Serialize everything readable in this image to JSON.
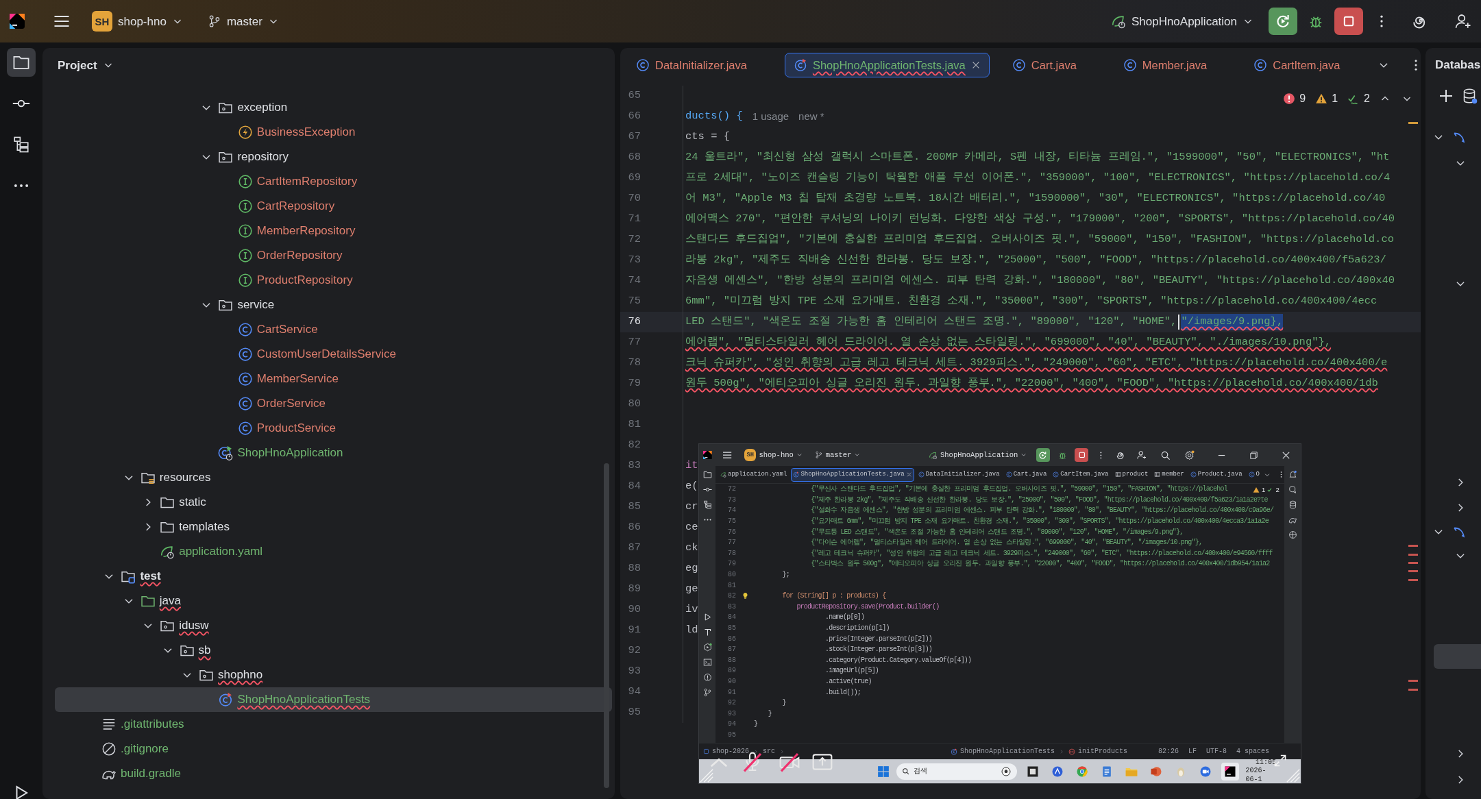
{
  "topbar": {
    "project_badge": "SH",
    "project": "shop-hno",
    "branch": "master",
    "run_config": "ShopHnoApplication"
  },
  "tool_strip": [
    {
      "kind": "project",
      "selected": true
    },
    {
      "kind": "commit",
      "selected": false
    },
    {
      "kind": "structure",
      "selected": false
    },
    {
      "kind": "more",
      "selected": false
    },
    {
      "kind": "run",
      "selected": false
    }
  ],
  "project_panel": {
    "title": "Project",
    "tree": [
      {
        "children": [
          {
            "children": [
              {
                "children": [
                  {
                    "children": [
                      {
                        "children": [
                          {
                            "children": [
                              {
                                "label": "exception",
                                "kind": "package",
                                "color": "#dfe1e5",
                                "expanded": true,
                                "selected": false,
                                "error": false,
                                "children": [
                                  {
                                    "label": "BusinessException",
                                    "kind": "exception",
                                    "color": "#df7f6e",
                                    "selected": false,
                                    "error": false
                                  }
                                ]
                              },
                              {
                                "label": "repository",
                                "kind": "package",
                                "color": "#dfe1e5",
                                "expanded": true,
                                "selected": false,
                                "error": false,
                                "children": [
                                  {
                                    "label": "CartItemRepository",
                                    "kind": "interface",
                                    "color": "#df7f6e",
                                    "selected": false,
                                    "error": false
                                  },
                                  {
                                    "label": "CartRepository",
                                    "kind": "interface",
                                    "color": "#df7f6e",
                                    "selected": false,
                                    "error": false
                                  },
                                  {
                                    "label": "MemberRepository",
                                    "kind": "interface",
                                    "color": "#df7f6e",
                                    "selected": false,
                                    "error": false
                                  },
                                  {
                                    "label": "OrderRepository",
                                    "kind": "interface",
                                    "color": "#df7f6e",
                                    "selected": false,
                                    "error": false
                                  },
                                  {
                                    "label": "ProductRepository",
                                    "kind": "interface",
                                    "color": "#df7f6e",
                                    "selected": false,
                                    "error": false
                                  }
                                ]
                              },
                              {
                                "label": "service",
                                "kind": "package",
                                "color": "#dfe1e5",
                                "expanded": true,
                                "selected": false,
                                "error": false,
                                "children": [
                                  {
                                    "label": "CartService",
                                    "kind": "class",
                                    "color": "#df7f6e",
                                    "selected": false,
                                    "error": false
                                  },
                                  {
                                    "label": "CustomUserDetailsService",
                                    "kind": "class",
                                    "color": "#df7f6e",
                                    "selected": false,
                                    "error": false
                                  },
                                  {
                                    "label": "MemberService",
                                    "kind": "class",
                                    "color": "#df7f6e",
                                    "selected": false,
                                    "error": false
                                  },
                                  {
                                    "label": "OrderService",
                                    "kind": "class",
                                    "color": "#df7f6e",
                                    "selected": false,
                                    "error": false
                                  },
                                  {
                                    "label": "ProductService",
                                    "kind": "class",
                                    "color": "#df7f6e",
                                    "selected": false,
                                    "error": false
                                  }
                                ]
                              },
                              {
                                "label": "ShopHnoApplication",
                                "kind": "spring-class",
                                "color": "#6fb56f",
                                "selected": false,
                                "error": false
                              }
                            ]
                          }
                        ]
                      }
                    ]
                  }
                ]
              },
              {
                "label": "resources",
                "kind": "resources",
                "color": "#dfe1e5",
                "expanded": true,
                "selected": false,
                "error": false,
                "children": [
                  {
                    "label": "static",
                    "kind": "folder",
                    "color": "#dfe1e5",
                    "expanded": false,
                    "selected": false,
                    "error": false
                  },
                  {
                    "label": "templates",
                    "kind": "folder",
                    "color": "#dfe1e5",
                    "expanded": false,
                    "selected": false,
                    "error": false
                  },
                  {
                    "label": "application.yaml",
                    "kind": "yaml",
                    "color": "#6fb56f",
                    "selected": false,
                    "error": false
                  }
                ]
              }
            ]
          },
          {
            "label": "test",
            "kind": "test-root",
            "color": "#dfe1e5",
            "expanded": true,
            "selected": false,
            "error": true,
            "children": [
              {
                "label": "java",
                "kind": "test-folder",
                "color": "#dfe1e5",
                "expanded": true,
                "selected": false,
                "error": true,
                "children": [
                  {
                    "label": "idusw",
                    "kind": "package",
                    "color": "#dfe1e5",
                    "expanded": true,
                    "selected": false,
                    "error": true,
                    "children": [
                      {
                        "label": "sb",
                        "kind": "package",
                        "color": "#dfe1e5",
                        "expanded": true,
                        "selected": false,
                        "error": true,
                        "children": [
                          {
                            "label": "shophno",
                            "kind": "package",
                            "color": "#dfe1e5",
                            "expanded": true,
                            "selected": false,
                            "error": true,
                            "children": [
                              {
                                "label": "ShopHnoApplicationTests",
                                "kind": "test-class",
                                "color": "#6fb56f",
                                "selected": true,
                                "error": true
                              }
                            ]
                          }
                        ]
                      }
                    ]
                  }
                ]
              }
            ]
          }
        ]
      },
      {
        "label": ".gitattributes",
        "kind": "text",
        "color": "#6fb56f",
        "selected": false,
        "error": false
      },
      {
        "label": ".gitignore",
        "kind": "ignore",
        "color": "#6fb56f",
        "selected": false,
        "error": false
      },
      {
        "label": "build.gradle",
        "kind": "gradle",
        "color": "#6fb56f",
        "selected": false,
        "error": false
      }
    ]
  },
  "editor": {
    "tabs": [
      {
        "label": "DataInitializer.java",
        "kind": "class",
        "color": "#df7f6e",
        "selected": false,
        "error": false
      },
      {
        "label": "ShopHnoApplicationTests.java",
        "kind": "test-class",
        "color": "#6fb56f",
        "selected": true,
        "error": true
      },
      {
        "label": "Cart.java",
        "kind": "class",
        "color": "#df7f6e",
        "selected": false,
        "error": false
      },
      {
        "label": "Member.java",
        "kind": "class",
        "color": "#df7f6e",
        "selected": false,
        "error": false
      },
      {
        "label": "CartItem.java",
        "kind": "class",
        "color": "#df7f6e",
        "selected": false,
        "error": false
      }
    ],
    "inspections": {
      "errors": "9",
      "warnings": "1",
      "typos": "2"
    },
    "lines": [
      {
        "number": "65",
        "current": false
      },
      {
        "number": "66",
        "text": "ducts() {",
        "kind": "decl",
        "hints": [
          "1 usage",
          "new *"
        ],
        "current": false,
        "error": false
      },
      {
        "number": "67",
        "text": "cts = {",
        "kind": "code",
        "current": false,
        "error": false
      },
      {
        "number": "68",
        "text": "24 울트라\", \"최신형 삼성 갤럭시 스마트폰. 200MP 카메라, S펜 내장, 티타늄 프레임.\", \"1599000\", \"50\", \"ELECTRONICS\", \"ht",
        "kind": "string",
        "current": false,
        "error": false
      },
      {
        "number": "69",
        "text": "프로 2세대\", \"노이즈 캔슬링 기능이 탁월한 애플 무선 이어폰.\", \"359000\", \"100\", \"ELECTRONICS\", \"https://placehold.co/4",
        "kind": "string",
        "current": false,
        "error": false
      },
      {
        "number": "70",
        "text": "어 M3\", \"Apple M3 칩 탑재 초경량 노트북. 18시간 배터리.\", \"1590000\", \"30\", \"ELECTRONICS\", \"https://placehold.co/40",
        "kind": "string",
        "current": false,
        "error": false
      },
      {
        "number": "71",
        "text": "에어맥스 270\", \"편안한 쿠셔닝의 나이키 런닝화. 다양한 색상 구성.\", \"179000\", \"200\", \"SPORTS\", \"https://placehold.co/40",
        "kind": "string",
        "current": false,
        "error": false
      },
      {
        "number": "72",
        "text": "스탠다드 후드집업\", \"기본에 충실한 프리미엄 후드집업. 오버사이즈 핏.\", \"59000\", \"150\", \"FASHION\", \"https://placehold.co",
        "kind": "string",
        "current": false,
        "error": false
      },
      {
        "number": "73",
        "text": "라봉 2kg\", \"제주도 직배송 신선한 한라봉. 당도 보장.\", \"25000\", \"500\", \"FOOD\", \"https://placehold.co/400x400/f5a623/",
        "kind": "string",
        "current": false,
        "error": false
      },
      {
        "number": "74",
        "text": "자음생 에센스\", \"한방 성분의 프리미엄 에센스. 피부 탄력 강화.\", \"180000\", \"80\", \"BEAUTY\", \"https://placehold.co/400x40",
        "kind": "string",
        "current": false,
        "error": false
      },
      {
        "number": "75",
        "text": "6mm\", \"미끄럼 방지 TPE 소재 요가매트. 친환경 소재.\", \"35000\", \"300\", \"SPORTS\", \"https://placehold.co/400x400/4ecc",
        "kind": "string",
        "current": false,
        "error": false
      },
      {
        "number": "76",
        "text": "LED 스탠드\", \"색온도 조절 가능한 홈 인테리어 스탠드 조명.\", \"89000\", \"120\", \"HOME\",",
        "selection": "\"/images/9.png},",
        "kind": "string",
        "current": true,
        "error": true
      },
      {
        "number": "77",
        "text": "에어랩\", \"멀티스타일러 헤어 드라이어. 열 손상 없는 스타일링.\", \"699000\", \"40\", \"BEAUTY\", \"./images/10.png\"},",
        "kind": "string",
        "current": false,
        "error": true
      },
      {
        "number": "78",
        "text": "크닉 슈퍼카\", \"성인 취향의 고급 레고 테크닉 세트. 3929피스.\", \"249000\", \"60\", \"ETC\", \"https://placehold.co/400x400/e",
        "kind": "string",
        "current": false,
        "error": true
      },
      {
        "number": "79",
        "text": "원두 500g\", \"에티오피아 싱글 오리진 원두. 과일향 풍부.\", \"22000\", \"400\", \"FOOD\", \"https://placehold.co/400x400/1db",
        "kind": "string",
        "current": false,
        "error": true
      },
      {
        "number": "80",
        "current": false
      },
      {
        "number": "81",
        "current": false
      },
      {
        "number": "82",
        "current": false
      },
      {
        "number": "83",
        "text": "it",
        "kind": "field",
        "current": false,
        "error": false
      },
      {
        "number": "84",
        "text": "e(",
        "kind": "code",
        "current": false,
        "error": false
      },
      {
        "number": "85",
        "text": "cr",
        "kind": "code",
        "current": false,
        "error": false
      },
      {
        "number": "86",
        "text": "ce",
        "kind": "code",
        "current": false,
        "error": false
      },
      {
        "number": "87",
        "text": "ck",
        "kind": "code",
        "current": false,
        "error": false
      },
      {
        "number": "88",
        "text": "eg",
        "kind": "code",
        "current": false,
        "error": false
      },
      {
        "number": "89",
        "text": "ge",
        "kind": "code",
        "current": false,
        "error": false
      },
      {
        "number": "90",
        "text": "iv",
        "kind": "code",
        "current": false,
        "error": false
      },
      {
        "number": "91",
        "text": "ld",
        "kind": "code",
        "current": false,
        "error": false
      },
      {
        "number": "92",
        "current": false
      },
      {
        "number": "93",
        "current": false
      },
      {
        "number": "94",
        "current": false
      },
      {
        "number": "95",
        "current": false
      }
    ],
    "screenshot": {
      "topbar": {
        "project_badge": "SH",
        "project": "shop-hno",
        "branch": "master",
        "run_config": "ShopHnoApplication"
      },
      "tabs": [
        {
          "label": "application.yaml",
          "kind": "yaml",
          "selected": false
        },
        {
          "label": "ShopHnoApplicationTests.java",
          "kind": "test-class",
          "selected": true
        },
        {
          "label": "DataInitializer.java",
          "kind": "class",
          "selected": false
        },
        {
          "label": "Cart.java",
          "kind": "class",
          "selected": false
        },
        {
          "label": "CartItem.java",
          "kind": "class",
          "selected": false
        },
        {
          "label": "product",
          "kind": "table",
          "selected": false
        },
        {
          "label": "member",
          "kind": "table",
          "selected": false
        },
        {
          "label": "Product.java",
          "kind": "class",
          "selected": false
        },
        {
          "label": "O",
          "kind": "class",
          "selected": false
        }
      ],
      "inspections": {
        "warnings": "1",
        "typos": "2"
      },
      "lines": [
        {
          "number": "72",
          "text": "                {\"무신사 스탠다드 후드집업\", \"기본에 충실한 프리미엄 후드집업. 오버사이즈 핏.\", \"59000\", \"150\", \"FASHION\", \"https://placehol",
          "kind": "string",
          "bulb": false
        },
        {
          "number": "73",
          "text": "                {\"제주 한라봉 2kg\", \"제주도 직배송 신선한 한라봉. 당도 보장.\", \"25000\", \"500\", \"FOOD\", \"https://placehold.co/400x400/f5a623/1a1a2e?te",
          "kind": "string",
          "bulb": false
        },
        {
          "number": "74",
          "text": "                {\"설화수 자음생 에센스\", \"한방 성분의 프리미엄 에센스. 피부 탄력 강화.\", \"180000\", \"80\", \"BEAUTY\", \"https://placehold.co/400x400/c9a96e/",
          "kind": "string",
          "bulb": false
        },
        {
          "number": "75",
          "text": "                {\"요가매트 6mm\", \"미끄럼 방지 TPE 소재 요가매트. 친환경 소재.\", \"35000\", \"300\", \"SPORTS\", \"https://placehold.co/400x400/4ecca3/1a1a2e",
          "kind": "string",
          "bulb": false
        },
        {
          "number": "76",
          "text": "                {\"무드등 LED 스탠드\", \"색온도 조절 가능한 홈 인테리어 스탠드 조명.\", \"89000\", \"120\", \"HOME\", \"/images/9.png\"},",
          "kind": "string",
          "bulb": false
        },
        {
          "number": "77",
          "text": "                {\"다이슨 에어랩\", \"멀티스타일러 헤어 드라이어. 열 손상 없는 스타일링.\", \"699000\", \"40\", \"BEAUTY\", \"/images/10.png\"},",
          "kind": "string",
          "bulb": false
        },
        {
          "number": "78",
          "text": "                {\"레고 테크닉 슈퍼카\", \"성인 취향의 고급 레고 테크닉 세트. 3929피스.\", \"249000\", \"60\", \"ETC\", \"https://placehold.co/400x400/e94560/ffff",
          "kind": "string",
          "bulb": false
        },
        {
          "number": "79",
          "text": "                {\"스타벅스 원두 500g\", \"에티오피아 싱글 오리진 원두. 과일향 풍부.\", \"22000\", \"400\", \"FOOD\", \"https://placehold.co/400x400/1db954/1a1a2",
          "kind": "string",
          "bulb": false
        },
        {
          "number": "80",
          "text": "        };",
          "kind": "code",
          "bulb": false
        },
        {
          "number": "81",
          "bulb": false
        },
        {
          "number": "82",
          "text": "        for (String[] p : products) {",
          "kind": "keyword",
          "bulb": true
        },
        {
          "number": "83",
          "text": "            productRepository.save(Product.builder()",
          "kind": "field",
          "bulb": false
        },
        {
          "number": "84",
          "text": "                    .name(p[0])",
          "kind": "code",
          "bulb": false
        },
        {
          "number": "85",
          "text": "                    .description(p[1])",
          "kind": "code",
          "bulb": false
        },
        {
          "number": "86",
          "text": "                    .price(Integer.parseInt(p[2]))",
          "kind": "code",
          "bulb": false
        },
        {
          "number": "87",
          "text": "                    .stock(Integer.parseInt(p[3]))",
          "kind": "code",
          "bulb": false
        },
        {
          "number": "88",
          "text": "                    .category(Product.Category.valueOf(p[4]))",
          "kind": "code",
          "bulb": false
        },
        {
          "number": "89",
          "text": "                    .imageUrl(p[5])",
          "kind": "code",
          "bulb": false
        },
        {
          "number": "90",
          "text": "                    .active(true)",
          "kind": "code",
          "bulb": false
        },
        {
          "number": "91",
          "text": "                    .build());",
          "kind": "code",
          "bulb": false
        },
        {
          "number": "92",
          "text": "        }",
          "kind": "code",
          "bulb": false
        },
        {
          "number": "93",
          "text": "    }",
          "kind": "code",
          "bulb": false
        },
        {
          "number": "94",
          "text": "}",
          "kind": "code",
          "bulb": false
        },
        {
          "number": "95",
          "bulb": false
        }
      ],
      "breadcrumb": [
        {
          "label": "shop-2026",
          "kind": "module"
        },
        {
          "label": "src",
          "kind": "plain"
        }
      ],
      "breadcrumb_tail": [
        {
          "label": "ShopHnoApplicationTests",
          "kind": "test-class"
        },
        {
          "label": "initProducts",
          "kind": "method"
        }
      ],
      "status": [
        "82:26",
        "LF",
        "UTF-8",
        "4 spaces"
      ],
      "taskbar": {
        "search": "검색",
        "apps": [
          {
            "kind": "terminal",
            "selected": false
          },
          {
            "kind": "store",
            "selected": false
          },
          {
            "kind": "chrome",
            "selected": false
          },
          {
            "kind": "notepad",
            "selected": false
          },
          {
            "kind": "explorer",
            "selected": false
          },
          {
            "kind": "powerpoint",
            "selected": false
          },
          {
            "kind": "penguin",
            "selected": false
          },
          {
            "kind": "zoom",
            "selected": false
          },
          {
            "kind": "intellij",
            "selected": true
          }
        ],
        "time": "11:05",
        "date": "2026-06-1"
      }
    }
  },
  "database_panel": {
    "title": "Databas"
  }
}
